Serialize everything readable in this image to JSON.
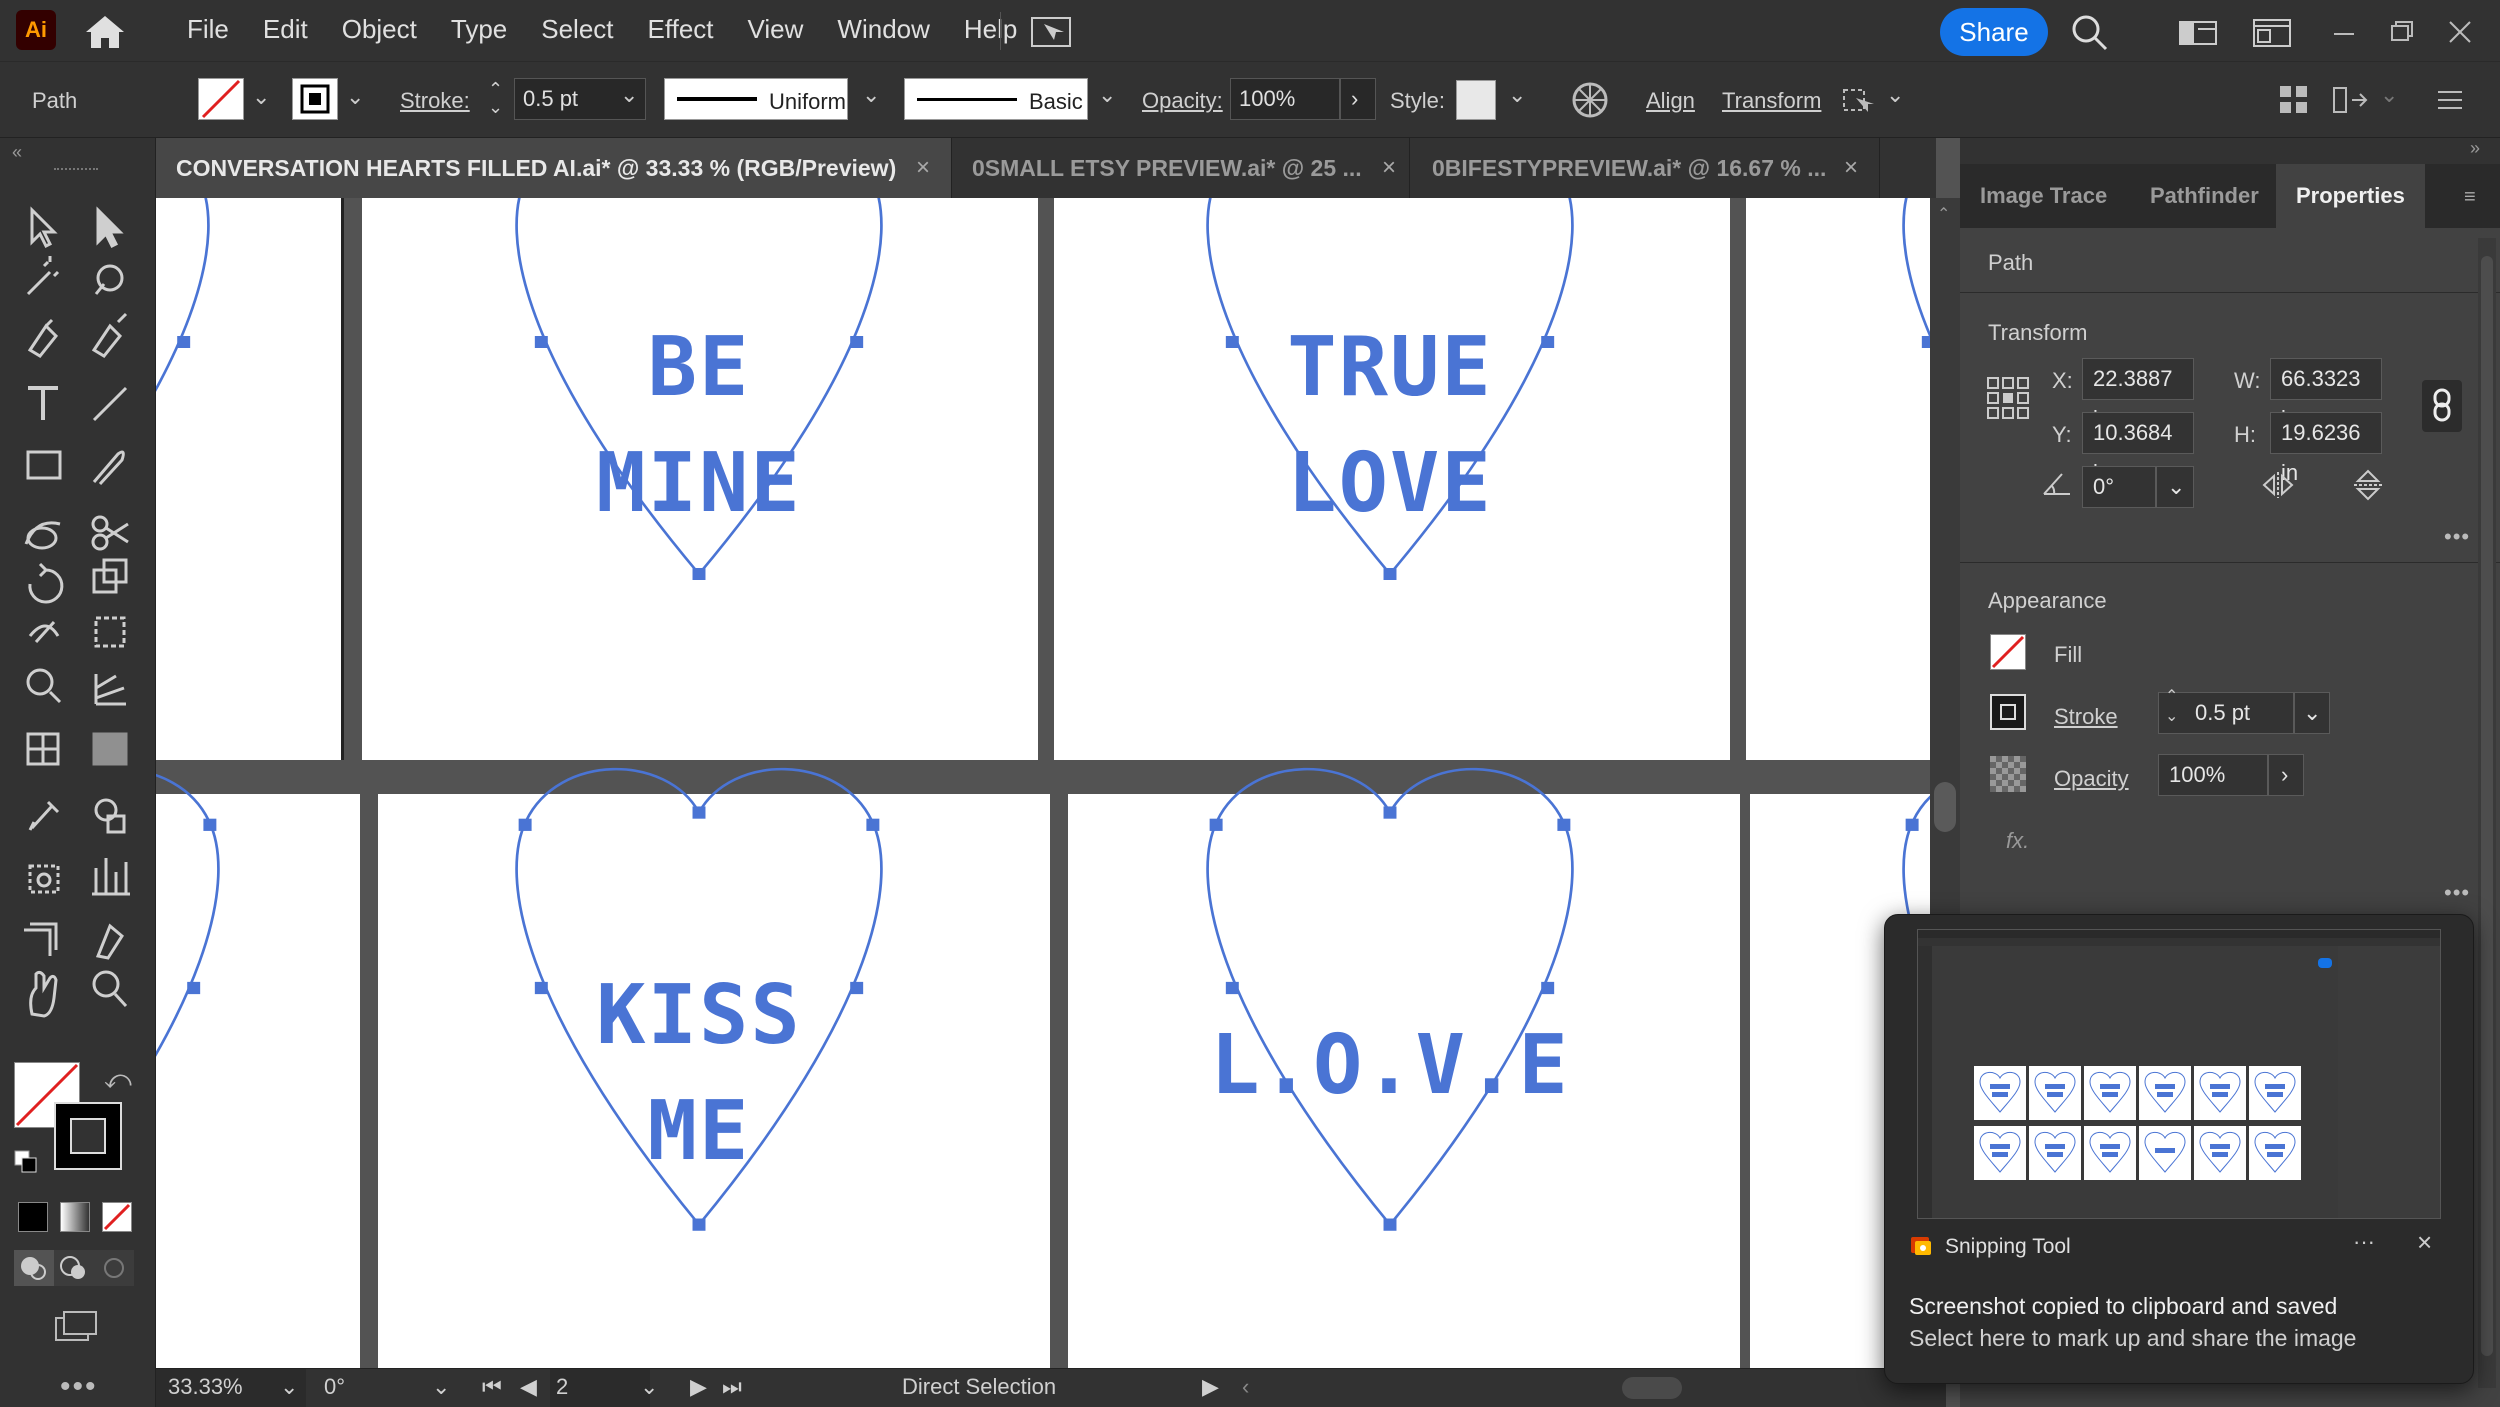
{
  "app": {
    "logo_text": "Ai",
    "menu": [
      "File",
      "Edit",
      "Object",
      "Type",
      "Select",
      "Effect",
      "View",
      "Window",
      "Help"
    ],
    "share_label": "Share"
  },
  "control_bar": {
    "object_type": "Path",
    "stroke_label": "Stroke:",
    "stroke_value": "0.5 pt",
    "profile_label": "Uniform",
    "brush_label": "Basic",
    "opacity_label": "Opacity:",
    "opacity_value": "100%",
    "style_label": "Style:",
    "align_label": "Align",
    "transform_label": "Transform"
  },
  "tabs": [
    {
      "label": "CONVERSATION HEARTS FILLED AI.ai* @ 33.33 % (RGB/Preview)",
      "active": true
    },
    {
      "label": "0SMALL ETSY PREVIEW.ai* @ 25 ...",
      "active": false
    },
    {
      "label": "0BIFESTYPREVIEW.ai* @ 16.67 % ...",
      "active": false
    }
  ],
  "canvas": {
    "heart_color": "#4a74d4",
    "hearts": [
      {
        "lines": [
          "BE",
          "MINE"
        ]
      },
      {
        "lines": [
          "TRUE",
          "LOVE"
        ]
      },
      {
        "lines": [
          "KISS",
          "ME"
        ]
      },
      {
        "lines": [
          "L.O.V.E"
        ]
      }
    ]
  },
  "properties_panel": {
    "tabs": [
      "Image Trace",
      "Pathfinder",
      "Properties"
    ],
    "active_tab": "Properties",
    "selection_type": "Path",
    "transform": {
      "title": "Transform",
      "x_label": "X:",
      "x": "22.3887 in",
      "y_label": "Y:",
      "y": "10.3684 in",
      "w_label": "W:",
      "w": "66.3323 in",
      "h_label": "H:",
      "h": "19.6236 in",
      "angle": "0°"
    },
    "appearance": {
      "title": "Appearance",
      "fill_label": "Fill",
      "stroke_label": "Stroke",
      "stroke_value": "0.5 pt",
      "opacity_label": "Opacity",
      "opacity_value": "100%",
      "fx_label": "fx."
    }
  },
  "status_bar": {
    "zoom": "33.33%",
    "rotation": "0°",
    "artboard_number": "2",
    "tool_name": "Direct Selection"
  },
  "notification": {
    "app_name": "Snipping Tool",
    "title": "Screenshot copied to clipboard and saved",
    "body": "Select here to mark up and share the image"
  }
}
